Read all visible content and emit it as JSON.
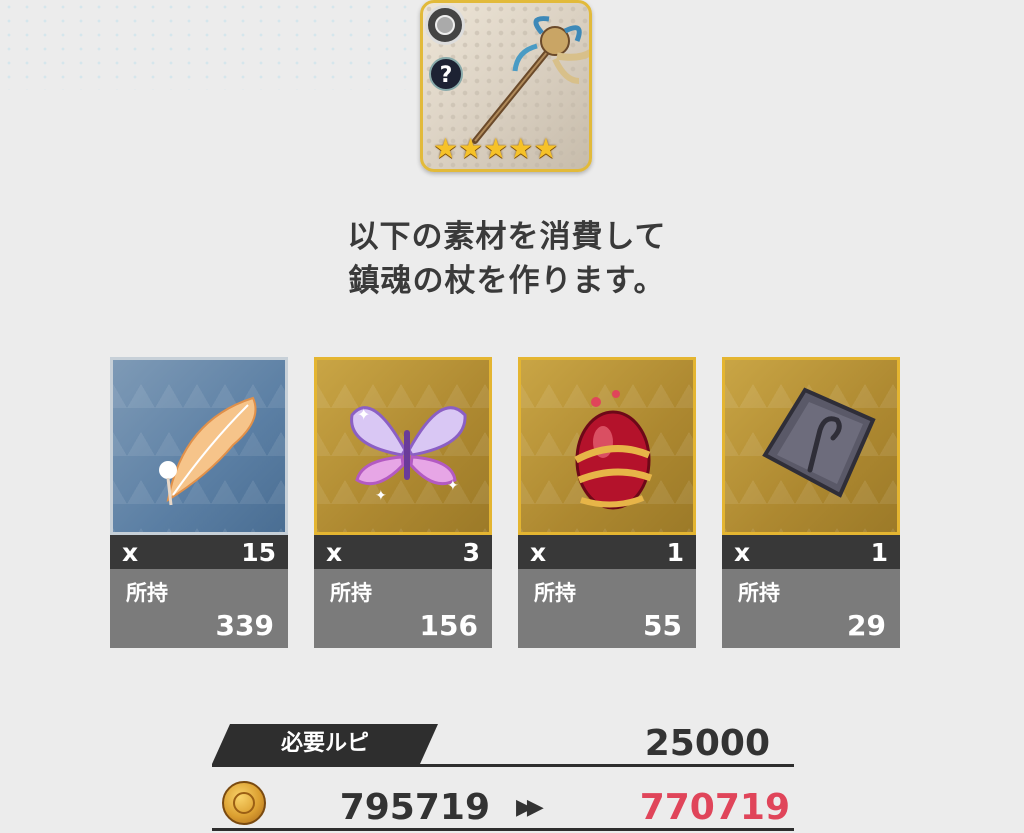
{
  "weapon": {
    "stars": "★★★★★",
    "type_badge": "?"
  },
  "instruction": {
    "line1": "以下の素材を消費して",
    "line2": "鎮魂の杖を作ります。"
  },
  "materials": [
    {
      "icon": "feather-icon",
      "qty_prefix": "x",
      "qty": "15",
      "owned_label": "所持",
      "owned": "339",
      "frame": "blue"
    },
    {
      "icon": "butterfly-icon",
      "qty_prefix": "x",
      "qty": "3",
      "owned_label": "所持",
      "owned": "156",
      "frame": "gold"
    },
    {
      "icon": "red-egg-icon",
      "qty_prefix": "x",
      "qty": "1",
      "owned_label": "所持",
      "owned": "55",
      "frame": "gold"
    },
    {
      "icon": "stone-tablet-icon",
      "qty_prefix": "x",
      "qty": "1",
      "owned_label": "所持",
      "owned": "29",
      "frame": "gold"
    }
  ],
  "cost": {
    "label": "必要ルピ",
    "required": "25000",
    "current": "795719",
    "arrow": "▶▶",
    "after": "770719"
  },
  "colors": {
    "gold_frame": "#e4b531",
    "after_value": "#e0455a",
    "dark_bar": "#383838",
    "owned_bg": "#7b7b7b"
  }
}
